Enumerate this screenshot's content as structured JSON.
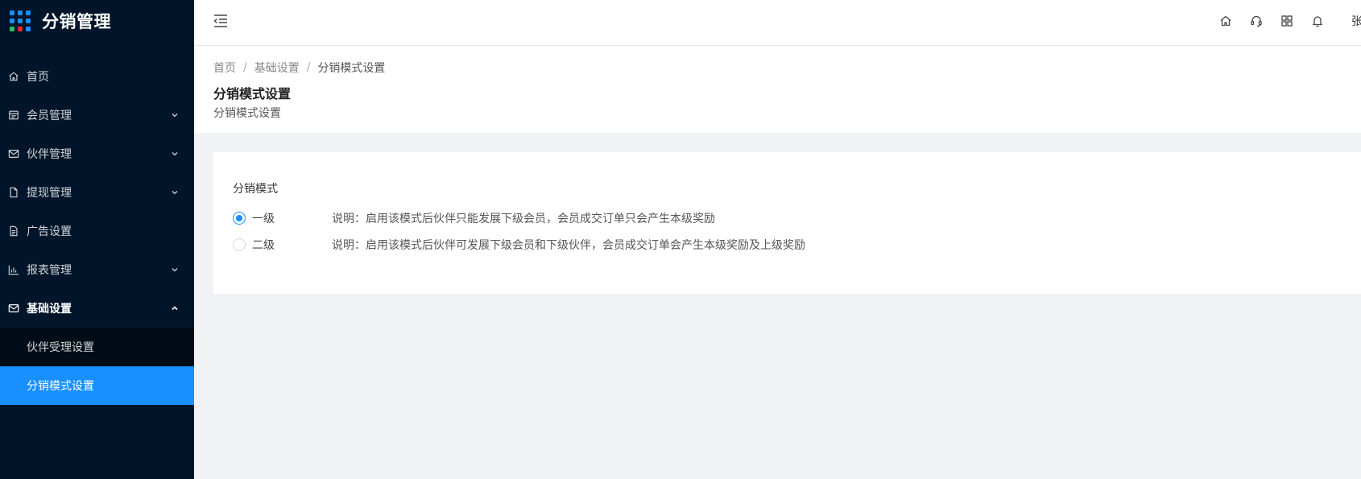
{
  "app": {
    "title": "分销管理",
    "logo_colors": [
      "#1890ff",
      "#1890ff",
      "#1890ff",
      "#1890ff",
      "#1890ff",
      "#1890ff",
      "#2fc25b",
      "#f5222d",
      "#1890ff"
    ]
  },
  "sidebar": {
    "items": [
      {
        "label": "首页",
        "icon": "home-icon",
        "has_arrow": false
      },
      {
        "label": "会员管理",
        "icon": "member-icon",
        "has_arrow": true
      },
      {
        "label": "伙伴管理",
        "icon": "mail-icon",
        "has_arrow": true
      },
      {
        "label": "提现管理",
        "icon": "file-icon",
        "has_arrow": true
      },
      {
        "label": "广告设置",
        "icon": "doc-icon",
        "has_arrow": false
      },
      {
        "label": "报表管理",
        "icon": "bar-chart-icon",
        "has_arrow": true
      },
      {
        "label": "基础设置",
        "icon": "mail-icon",
        "has_arrow": true,
        "expanded": true
      }
    ],
    "submenu": [
      {
        "label": "伙伴受理设置",
        "selected": false
      },
      {
        "label": "分销模式设置",
        "selected": true
      }
    ]
  },
  "header": {
    "icons": [
      "home-icon",
      "headset-icon",
      "apps-icon",
      "bell-icon"
    ],
    "user_name": "张"
  },
  "breadcrumb": {
    "items": [
      "首页",
      "基础设置",
      "分销模式设置"
    ],
    "separator": "/"
  },
  "page": {
    "title": "分销模式设置",
    "subtitle": "分销模式设置"
  },
  "form": {
    "label": "分销模式",
    "options": [
      {
        "label": "一级",
        "checked": true,
        "desc": "说明：启用该模式后伙伴只能发展下级会员，会员成交订单只会产生本级奖励"
      },
      {
        "label": "二级",
        "checked": false,
        "desc": "说明：启用该模式后伙伴可发展下级会员和下级伙伴，会员成交订单会产生本级奖励及上级奖励"
      }
    ]
  },
  "colors": {
    "sidebar_bg": "#001529",
    "submenu_bg": "#000c17",
    "accent": "#1890ff"
  }
}
